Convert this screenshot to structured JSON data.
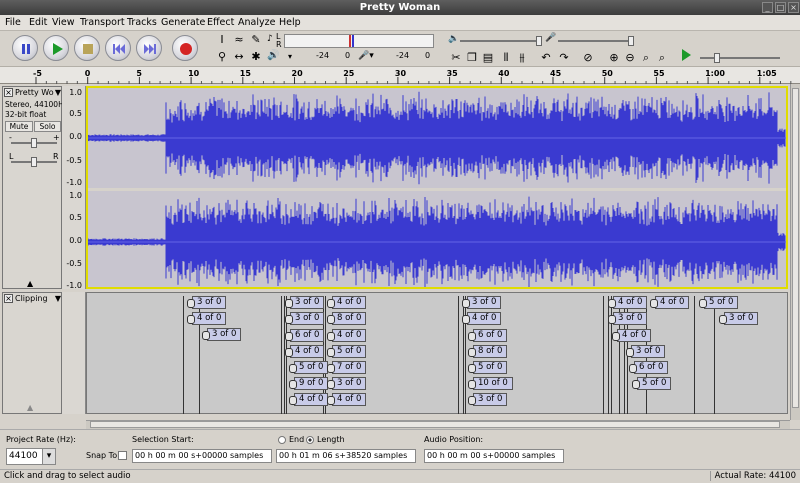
{
  "window": {
    "title": "Pretty Woman"
  },
  "menu": [
    "File",
    "Edit",
    "View",
    "Transport",
    "Tracks",
    "Generate",
    "Effect",
    "Analyze",
    "Help"
  ],
  "meters": {
    "left_label": "L",
    "right_label": "R",
    "ticks": [
      "-24",
      "0"
    ]
  },
  "rate_select": "8",
  "ruler": {
    "ticks": [
      "-5",
      "0",
      "5",
      "10",
      "15",
      "20",
      "25",
      "30",
      "35",
      "40",
      "45",
      "50",
      "55",
      "1:00",
      "1:05"
    ]
  },
  "audio_track": {
    "name": "Pretty Wo",
    "info1": "Stereo, 44100Hz",
    "info2": "32-bit float",
    "mute": "Mute",
    "solo": "Solo",
    "gain_minus": "-",
    "gain_plus": "+",
    "pan_l": "L",
    "pan_r": "R",
    "scale": [
      "1.0",
      "0.5",
      "0.0",
      "-0.5",
      "-1.0"
    ]
  },
  "label_track": {
    "name": "Clipping",
    "labels": [
      {
        "text": "3 of 0"
      },
      {
        "text": "4 of 0"
      },
      {
        "text": "3 of 0"
      },
      {
        "text": "3 of 0"
      },
      {
        "text": "3 of 0"
      },
      {
        "text": "6 of 0"
      },
      {
        "text": "4 of 0"
      },
      {
        "text": "5 of 0"
      },
      {
        "text": "9 of 0"
      },
      {
        "text": "4 of 0"
      },
      {
        "text": "4 of 0"
      },
      {
        "text": "8 of 0"
      },
      {
        "text": "4 of 0"
      },
      {
        "text": "5 of 0"
      },
      {
        "text": "7 of 0"
      },
      {
        "text": "3 of 0"
      },
      {
        "text": "4 of 0"
      },
      {
        "text": "3 of 0"
      },
      {
        "text": "4 of 0"
      },
      {
        "text": "6 of 0"
      },
      {
        "text": "8 of 0"
      },
      {
        "text": "5 of 0"
      },
      {
        "text": "10 of 0"
      },
      {
        "text": "3 of 0"
      },
      {
        "text": "4 of 0"
      },
      {
        "text": "3 of 0"
      },
      {
        "text": "4 of 0"
      },
      {
        "text": "3 of 0"
      },
      {
        "text": "6 of 0"
      },
      {
        "text": "5 of 0"
      },
      {
        "text": "4 of 0"
      },
      {
        "text": "5 of 0"
      },
      {
        "text": "3 of 0"
      }
    ]
  },
  "bottom": {
    "project_rate_label": "Project Rate (Hz):",
    "project_rate": "44100",
    "snap_to": "Snap To",
    "selection_start_label": "Selection Start:",
    "end_label": "End",
    "length_label": "Length",
    "sel_start": "00 h 00 m 00 s+00000 samples",
    "sel_length": "00 h 01 m 06 s+38520 samples",
    "audio_position_label": "Audio Position:",
    "audio_pos": "00 h 00 m 00 s+00000 samples"
  },
  "status": {
    "left": "Click and drag to select audio",
    "right": "Actual Rate: 44100"
  }
}
